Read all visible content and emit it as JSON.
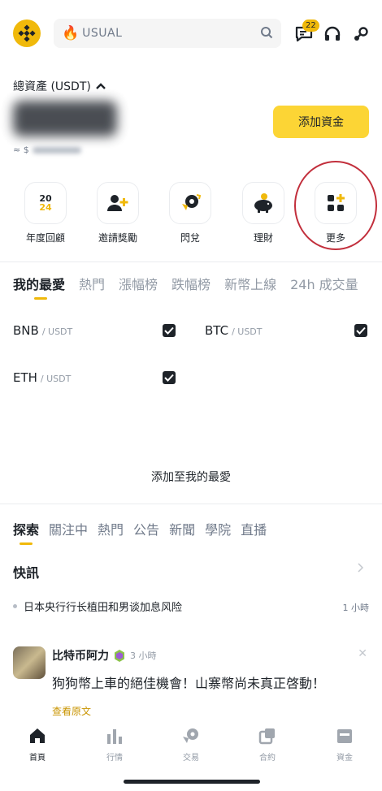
{
  "header": {
    "search_placeholder": "USUAL",
    "notification_count": "22"
  },
  "assets": {
    "label": "總資產 (USDT)",
    "approx_prefix": "≈ $",
    "add_funds": "添加資金"
  },
  "quick_actions": [
    {
      "label": "年度回顧",
      "icon": "2024-calendar-icon",
      "icon_text_top": "20",
      "icon_text_bottom": "24"
    },
    {
      "label": "邀請獎勵",
      "icon": "add-user-icon"
    },
    {
      "label": "閃兌",
      "icon": "swap-coin-icon"
    },
    {
      "label": "理財",
      "icon": "piggy-bank-icon"
    },
    {
      "label": "更多",
      "icon": "grid-plus-icon"
    }
  ],
  "market_tabs": [
    "我的最愛",
    "熱門",
    "漲幅榜",
    "跌幅榜",
    "新幣上線",
    "24h 成交量"
  ],
  "favorites": [
    {
      "symbol": "BNB",
      "quote": "/ USDT"
    },
    {
      "symbol": "BTC",
      "quote": "/ USDT"
    },
    {
      "symbol": "ETH",
      "quote": "/ USDT"
    }
  ],
  "add_to_favorites": "添加至我的最愛",
  "content_tabs": [
    "探索",
    "關注中",
    "熱門",
    "公告",
    "新聞",
    "學院",
    "直播"
  ],
  "flash_news": {
    "title": "快訊",
    "headline": "日本央行行长植田和男谈加息风险",
    "time": "1 小時"
  },
  "post": {
    "author": "比特币阿力",
    "time": "3 小時",
    "text": "狗狗幣上車的絕佳機會！山寨幣尚未真正啓動！",
    "view_original": "查看原文"
  },
  "bottom_nav": [
    {
      "label": "首頁",
      "icon": "home-icon"
    },
    {
      "label": "行情",
      "icon": "bar-chart-icon"
    },
    {
      "label": "交易",
      "icon": "trade-icon"
    },
    {
      "label": "合約",
      "icon": "futures-icon"
    },
    {
      "label": "資金",
      "icon": "wallet-icon"
    }
  ],
  "colors": {
    "accent": "#f0b90b",
    "button": "#fcd535",
    "annotation": "#c22f3c"
  }
}
